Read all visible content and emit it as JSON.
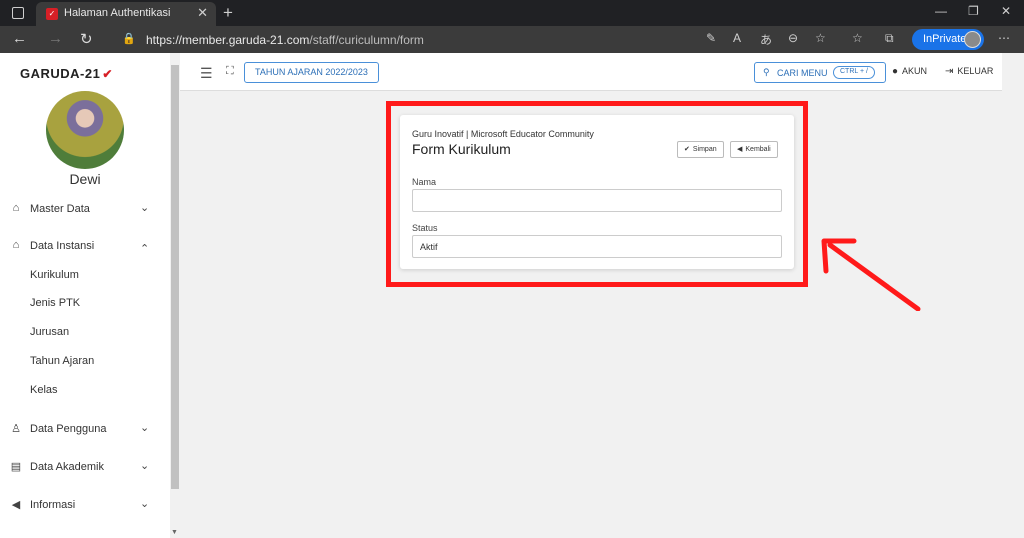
{
  "browser": {
    "tab_title": "Halaman Authentikasi",
    "tab_close": "✕",
    "new_tab": "+",
    "url_host": "https://member.garuda-21.com",
    "url_path": "/staff/curiculumn/form",
    "inprivate_label": "InPrivate"
  },
  "brand": {
    "logo_text": "GARUDA-21"
  },
  "profile": {
    "name": "Dewi"
  },
  "sidebar": {
    "items": [
      {
        "label": "Master Data",
        "icon": "home-icon",
        "expanded": false
      },
      {
        "label": "Data Instansi",
        "icon": "institution-icon",
        "expanded": true
      },
      {
        "label": "Data Pengguna",
        "icon": "user-icon",
        "expanded": false
      },
      {
        "label": "Data Akademik",
        "icon": "book-icon",
        "expanded": false
      },
      {
        "label": "Informasi",
        "icon": "megaphone-icon",
        "expanded": false
      }
    ],
    "sub_items": [
      "Kurikulum",
      "Jenis PTK",
      "Jurusan",
      "Tahun Ajaran",
      "Kelas"
    ]
  },
  "topbar": {
    "year_button": "TAHUN AJARAN 2022/2023",
    "search_label": "CARI MENU",
    "search_shortcut": "CTRL + /",
    "account_label": "AKUN",
    "logout_label": "KELUAR"
  },
  "form": {
    "subtitle": "Guru Inovatif | Microsoft Educator Community",
    "title": "Form Kurikulum",
    "save_label": "Simpan",
    "back_label": "Kembali",
    "fields": [
      {
        "label": "Nama",
        "value": ""
      },
      {
        "label": "Status",
        "value": "Aktif"
      }
    ]
  },
  "colors": {
    "highlight": "#ff1a1a",
    "accent": "#2c6fb7",
    "brand": "#d71f26"
  }
}
